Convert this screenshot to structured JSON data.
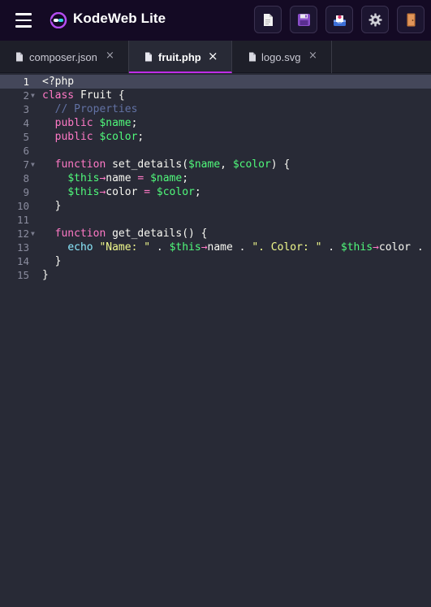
{
  "app": {
    "title": "KodeWeb Lite"
  },
  "toolbar": {
    "buttons": [
      {
        "name": "new-file",
        "icon": "file-icon"
      },
      {
        "name": "save",
        "icon": "floppy-icon"
      },
      {
        "name": "export",
        "icon": "inbox-icon"
      },
      {
        "name": "settings",
        "icon": "gear-icon"
      },
      {
        "name": "exit",
        "icon": "door-icon"
      }
    ]
  },
  "tabs": [
    {
      "label": "composer.json",
      "active": false,
      "close": "×"
    },
    {
      "label": "fruit.php",
      "active": true,
      "close": "×"
    },
    {
      "label": "logo.svg",
      "active": false,
      "close": "×"
    }
  ],
  "editor": {
    "current_line": 1,
    "lines": [
      {
        "num": "1",
        "text": "<?php"
      },
      {
        "num": "2",
        "text": "class Fruit {",
        "fold": true
      },
      {
        "num": "3",
        "text": "  // Properties"
      },
      {
        "num": "4",
        "text": "  public $name;"
      },
      {
        "num": "5",
        "text": "  public $color;"
      },
      {
        "num": "6",
        "text": ""
      },
      {
        "num": "7",
        "text": "  function set_details($name, $color) {",
        "fold": true
      },
      {
        "num": "8",
        "text": "    $this→name = $name;"
      },
      {
        "num": "9",
        "text": "    $this→color = $color;"
      },
      {
        "num": "10",
        "text": "  }"
      },
      {
        "num": "11",
        "text": ""
      },
      {
        "num": "12",
        "text": "  function get_details() {",
        "fold": true
      },
      {
        "num": "13",
        "text": "    echo \"Name: \" . $this→name . \". Color: \" . $this→color ."
      },
      {
        "num": "14",
        "text": "  }"
      },
      {
        "num": "15",
        "text": "}"
      }
    ]
  },
  "colors": {
    "keyword": "#ff79c6",
    "variable": "#50fa7b",
    "string": "#f1fa8c",
    "builtin": "#8be9fd",
    "comment": "#6272a4",
    "tab_accent": "#c02de8"
  }
}
